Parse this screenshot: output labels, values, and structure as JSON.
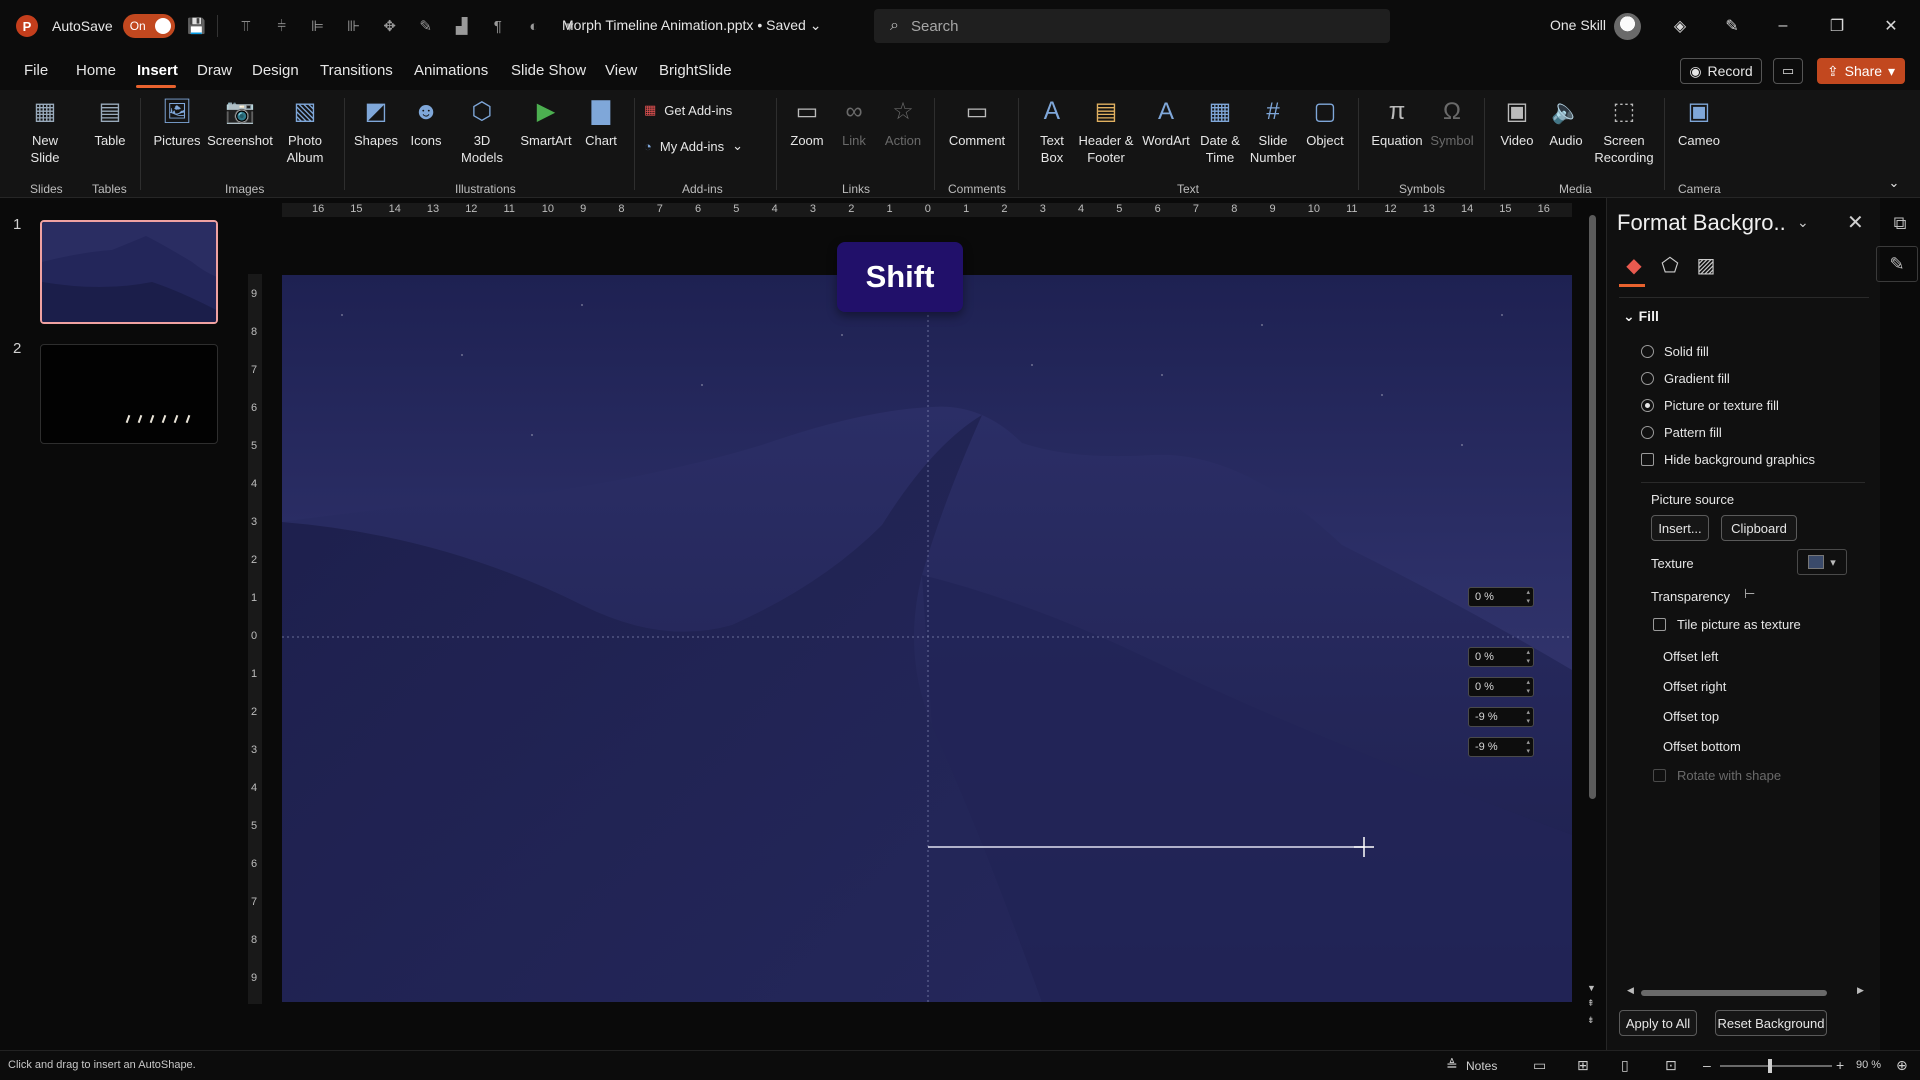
{
  "titlebar": {
    "app_logo": "P",
    "autosave_label": "AutoSave",
    "autosave_state": "On",
    "doc_title": "Morph Timeline Animation.pptx • Saved",
    "search_placeholder": "Search",
    "user_name": "One Skill",
    "minimize": "–",
    "maximize": "❐",
    "close": "✕"
  },
  "menu": {
    "tabs": [
      "File",
      "Home",
      "Insert",
      "Draw",
      "Design",
      "Transitions",
      "Animations",
      "Slide Show",
      "View",
      "BrightSlide"
    ],
    "active": "Insert",
    "record_label": "Record",
    "share_label": "Share"
  },
  "ribbon": {
    "new_slide": "New Slide",
    "table": "Table",
    "pictures": "Pictures",
    "screenshot": "Screenshot",
    "photo_album": "Photo Album",
    "shapes": "Shapes",
    "icons": "Icons",
    "models_3d": "3D Models",
    "smartart": "SmartArt",
    "chart": "Chart",
    "get_addins": "Get Add-ins",
    "my_addins": "My Add-ins",
    "zoom": "Zoom",
    "link": "Link",
    "action": "Action",
    "comment": "Comment",
    "text_box": "Text Box",
    "header_footer": "Header & Footer",
    "wordart": "WordArt",
    "date_time": "Date & Time",
    "slide_number": "Slide Number",
    "object": "Object",
    "equation": "Equation",
    "symbol": "Symbol",
    "video": "Video",
    "audio": "Audio",
    "screen_recording": "Screen Recording",
    "cameo": "Cameo",
    "groups": {
      "slides": "Slides",
      "tables": "Tables",
      "images": "Images",
      "illustrations": "Illustrations",
      "addins": "Add-ins",
      "links": "Links",
      "comments": "Comments",
      "text": "Text",
      "symbols": "Symbols",
      "media": "Media",
      "camera": "Camera"
    }
  },
  "thumbnails": {
    "slide1_num": "1",
    "slide2_num": "2"
  },
  "ruler": {
    "horizontal": [
      "16",
      "15",
      "14",
      "13",
      "12",
      "11",
      "10",
      "9",
      "8",
      "7",
      "6",
      "5",
      "4",
      "3",
      "2",
      "1",
      "0",
      "1",
      "2",
      "3",
      "4",
      "5",
      "6",
      "7",
      "8",
      "9",
      "10",
      "11",
      "12",
      "13",
      "14",
      "15",
      "16"
    ],
    "vertical": [
      "9",
      "8",
      "7",
      "6",
      "5",
      "4",
      "3",
      "2",
      "1",
      "0",
      "1",
      "2",
      "3",
      "4",
      "5",
      "6",
      "7",
      "8",
      "9"
    ]
  },
  "slide": {
    "key_overlay": "Shift"
  },
  "format_pane": {
    "title": "Format Backgro..",
    "section": "Fill",
    "options": [
      {
        "label": "Solid fill",
        "checked": false
      },
      {
        "label": "Gradient fill",
        "checked": false
      },
      {
        "label": "Picture or texture fill",
        "checked": true
      },
      {
        "label": "Pattern fill",
        "checked": false
      }
    ],
    "hide_bg": "Hide background graphics",
    "picture_source": "Picture source",
    "insert_btn": "Insert...",
    "clipboard_btn": "Clipboard",
    "texture": "Texture",
    "transparency": "Transparency",
    "transparency_value": "0 %",
    "tile_picture": "Tile picture as texture",
    "offset_left": "Offset left",
    "offset_left_value": "0 %",
    "offset_right": "Offset right",
    "offset_right_value": "0 %",
    "offset_top": "Offset top",
    "offset_top_value": "-9 %",
    "offset_bottom": "Offset bottom",
    "offset_bottom_value": "-9 %",
    "rotate_with_shape": "Rotate with shape",
    "apply_all": "Apply to All",
    "reset_bg": "Reset Background"
  },
  "statusbar": {
    "message": "Click and drag to insert an AutoShape.",
    "notes": "Notes",
    "zoom": "90 %"
  },
  "colors": {
    "accent": "#c2481f",
    "underline": "#e8622e",
    "thumb_border": "#f0a2a2",
    "key_overlay_bg": "#21106a"
  }
}
